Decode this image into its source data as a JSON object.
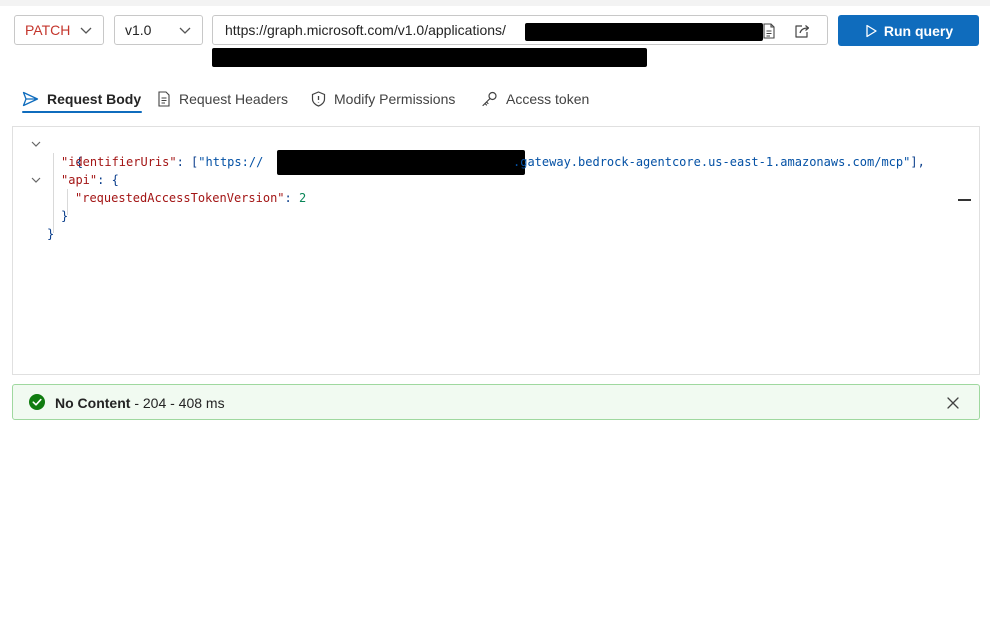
{
  "toolbar": {
    "method": "PATCH",
    "version": "v1.0",
    "url_prefix": "https://graph.microsoft.com/v1.0/applications/",
    "run_label": "Run query"
  },
  "tabs": [
    {
      "label": "Request Body",
      "icon": "send-icon",
      "active": true
    },
    {
      "label": "Request Headers",
      "icon": "document-icon",
      "active": false
    },
    {
      "label": "Modify Permissions",
      "icon": "shield-icon",
      "active": false
    },
    {
      "label": "Access token",
      "icon": "key-icon",
      "active": false
    }
  ],
  "editor": {
    "line1_open": "{",
    "key_identifierUris": "\"identifierUris\"",
    "colon_open_bracket": ": [",
    "str_https_prefix": "\"https://",
    "str_gateway_suffix": ".gateway.bedrock-agentcore.us-east-1.amazonaws.com/mcp\"",
    "close_bracket_comma": "],",
    "key_api": "\"api\"",
    "colon_open_brace": ": {",
    "key_requestedAccessTokenVersion": "\"requestedAccessTokenVersion\"",
    "colon": ": ",
    "value_version": "2",
    "inner_close": "}",
    "outer_close": "}"
  },
  "status": {
    "title": "No Content",
    "detail": " - 204 - 408 ms",
    "color": "#107c10"
  },
  "colors": {
    "accent": "#0f6cbd",
    "method": "#c4352c",
    "json_key": "#a31515",
    "json_string": "#0451a5",
    "json_number": "#098658"
  }
}
